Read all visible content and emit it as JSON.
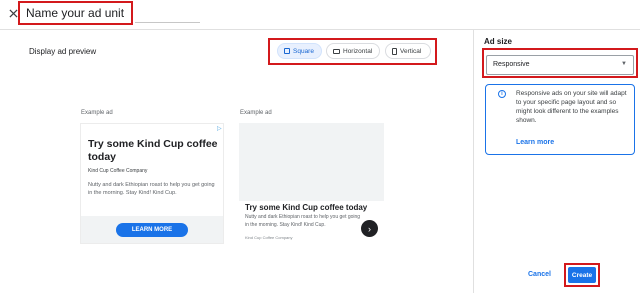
{
  "header": {
    "close_icon": "close-icon",
    "ad_unit_name": "Name your ad unit"
  },
  "preview": {
    "title": "Display ad preview",
    "toggles": [
      {
        "label": "Square",
        "icon": "square-icon",
        "active": true
      },
      {
        "label": "Horizontal",
        "icon": "horizontal-rect-icon",
        "active": false
      },
      {
        "label": "Vertical",
        "icon": "vertical-rect-icon",
        "active": false
      }
    ],
    "example_label": "Example ad",
    "ad1": {
      "headline": "Try some Kind Cup coffee today",
      "advertiser": "Kind Cup Coffee Company",
      "description": "Nutty and dark Ethiopian roast to help you get going in the morning. Stay Kind! Kind Cup.",
      "cta": "LEARN MORE",
      "adchoices_icon": "adchoices-icon"
    },
    "ad2": {
      "headline": "Try some Kind Cup coffee today",
      "description": "Nutty and dark Ethiopian roast to help you get going in the morning. Stay Kind! Kind Cup.",
      "advertiser": "Kind Cup Coffee Company",
      "arrow_icon": "chevron-right-icon"
    }
  },
  "sidebar": {
    "ad_size_label": "Ad size",
    "ad_size_value": "Responsive",
    "info_text": "Responsive ads on your site will adapt to your specific page layout and so might look different to the examples shown.",
    "learn_more": "Learn more",
    "cancel": "Cancel",
    "create": "Create"
  },
  "colors": {
    "accent": "#1a73e8",
    "highlight_border": "#d3191c"
  }
}
